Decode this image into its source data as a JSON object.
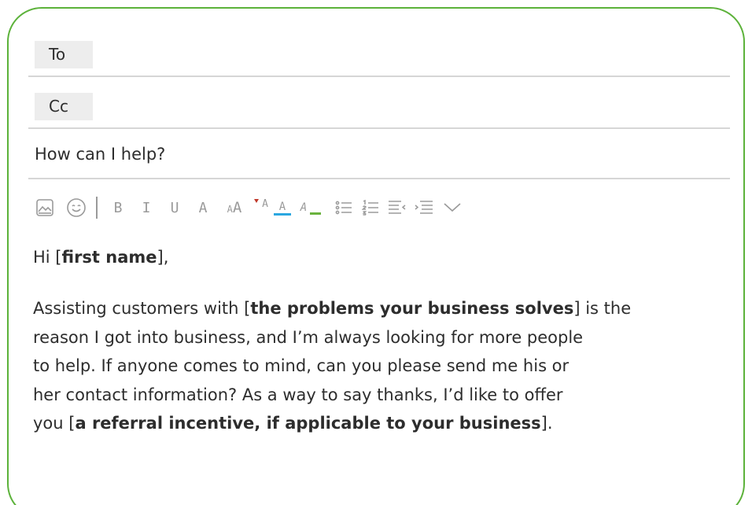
{
  "compose": {
    "to_label": "To",
    "cc_label": "Cc",
    "subject": "How can I help?"
  },
  "toolbar": {
    "bold": "B",
    "italic": "I",
    "underline": "U",
    "font": "A",
    "font_size_small": "A",
    "font_size_large": "A",
    "superscript": "A",
    "text_color": "A",
    "highlight": "A",
    "colors": {
      "text_color_underline": "#2aa7e0",
      "highlight_underline": "#6ab33e",
      "superscript_marker": "#c0392b"
    }
  },
  "message": {
    "greeting_prefix": "Hi [",
    "greeting_bold": "first name",
    "greeting_suffix": "],",
    "p1_prefix": "Assisting customers with [",
    "p1_bold": "the problems your business solves",
    "p1_suffix": "] is the",
    "line2": "reason I got into business, and I’m always looking for more people",
    "line3": "to help. If anyone comes to mind, can you please send me his or",
    "line4": "her contact information? As a way to say thanks, I’d like to offer",
    "line5_prefix": "you [",
    "line5_bold": "a referral incentive, if applicable to your business",
    "line5_suffix": "]."
  }
}
